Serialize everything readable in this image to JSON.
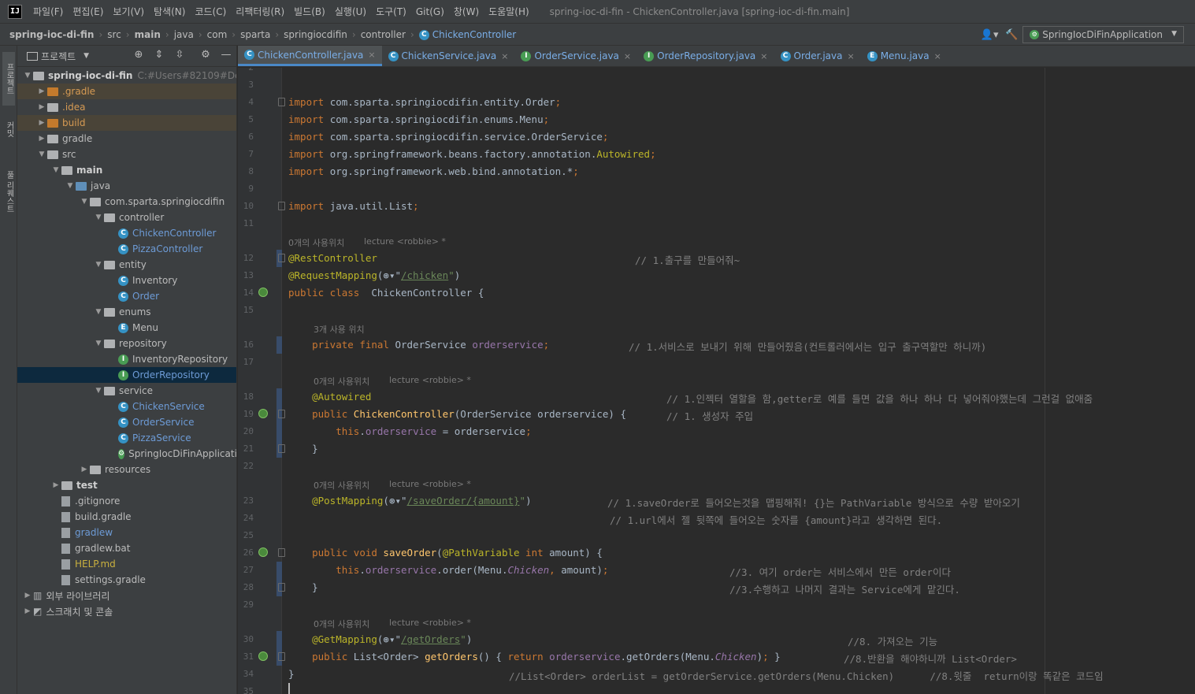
{
  "menubar": {
    "logo": "IJ",
    "items": [
      "파일(F)",
      "편집(E)",
      "보기(V)",
      "탐색(N)",
      "코드(C)",
      "리팩터링(R)",
      "빌드(B)",
      "실행(U)",
      "도구(T)",
      "Git(G)",
      "창(W)",
      "도움말(H)"
    ],
    "window_title": "spring-ioc-di-fin - ChickenController.java [spring-ioc-di-fin.main]"
  },
  "navbar": {
    "crumbs": [
      "spring-ioc-di-fin",
      "src",
      "main",
      "java",
      "com",
      "sparta",
      "springiocdifin",
      "controller",
      "ChickenController"
    ],
    "class_icon": "C",
    "run_config": "SpringIocDiFinApplication"
  },
  "toolstrip": {
    "tabs": [
      "프로젝트",
      "커밋",
      "풀 리퀘스트"
    ]
  },
  "project": {
    "title": "프로젝트",
    "tree": [
      {
        "depth": 0,
        "arrow": "▼",
        "icon": "folder",
        "label": "spring-ioc-di-fin",
        "style": "bold",
        "hint": "C:#Users#82109#Deskto"
      },
      {
        "depth": 1,
        "arrow": "▶",
        "icon": "folder-orange",
        "label": ".gradle",
        "style": "orange",
        "row": "hl"
      },
      {
        "depth": 1,
        "arrow": "▶",
        "icon": "folder",
        "label": ".idea",
        "style": "orange"
      },
      {
        "depth": 1,
        "arrow": "▶",
        "icon": "folder-orange",
        "label": "build",
        "style": "orange",
        "row": "hl"
      },
      {
        "depth": 1,
        "arrow": "▶",
        "icon": "folder",
        "label": "gradle",
        "style": ""
      },
      {
        "depth": 1,
        "arrow": "▼",
        "icon": "folder",
        "label": "src",
        "style": ""
      },
      {
        "depth": 2,
        "arrow": "▼",
        "icon": "folder",
        "label": "main",
        "style": "bold"
      },
      {
        "depth": 3,
        "arrow": "▼",
        "icon": "folder-blue",
        "label": "java",
        "style": ""
      },
      {
        "depth": 4,
        "arrow": "▼",
        "icon": "folder",
        "label": "com.sparta.springiocdifin",
        "style": ""
      },
      {
        "depth": 5,
        "arrow": "▼",
        "icon": "folder",
        "label": "controller",
        "style": ""
      },
      {
        "depth": 6,
        "arrow": "",
        "icon": "class",
        "label": "ChickenController",
        "style": "blue"
      },
      {
        "depth": 6,
        "arrow": "",
        "icon": "class",
        "label": "PizzaController",
        "style": "blue"
      },
      {
        "depth": 5,
        "arrow": "▼",
        "icon": "folder",
        "label": "entity",
        "style": ""
      },
      {
        "depth": 6,
        "arrow": "",
        "icon": "class",
        "label": "Inventory",
        "style": ""
      },
      {
        "depth": 6,
        "arrow": "",
        "icon": "class",
        "label": "Order",
        "style": "blue"
      },
      {
        "depth": 5,
        "arrow": "▼",
        "icon": "folder",
        "label": "enums",
        "style": ""
      },
      {
        "depth": 6,
        "arrow": "",
        "icon": "enum",
        "label": "Menu",
        "style": ""
      },
      {
        "depth": 5,
        "arrow": "▼",
        "icon": "folder",
        "label": "repository",
        "style": ""
      },
      {
        "depth": 6,
        "arrow": "",
        "icon": "interface",
        "label": "InventoryRepository",
        "style": ""
      },
      {
        "depth": 6,
        "arrow": "",
        "icon": "interface",
        "label": "OrderRepository",
        "style": "blue",
        "row": "sel"
      },
      {
        "depth": 5,
        "arrow": "▼",
        "icon": "folder",
        "label": "service",
        "style": ""
      },
      {
        "depth": 6,
        "arrow": "",
        "icon": "class",
        "label": "ChickenService",
        "style": "blue"
      },
      {
        "depth": 6,
        "arrow": "",
        "icon": "class",
        "label": "OrderService",
        "style": "blue"
      },
      {
        "depth": 6,
        "arrow": "",
        "icon": "class",
        "label": "PizzaService",
        "style": "blue"
      },
      {
        "depth": 6,
        "arrow": "",
        "icon": "springapp",
        "label": "SpringIocDiFinApplication",
        "style": ""
      },
      {
        "depth": 4,
        "arrow": "▶",
        "icon": "folder",
        "label": "resources",
        "style": ""
      },
      {
        "depth": 2,
        "arrow": "▶",
        "icon": "folder",
        "label": "test",
        "style": "bold"
      },
      {
        "depth": 2,
        "arrow": "",
        "icon": "file",
        "label": ".gitignore",
        "style": ""
      },
      {
        "depth": 2,
        "arrow": "",
        "icon": "file",
        "label": "build.gradle",
        "style": ""
      },
      {
        "depth": 2,
        "arrow": "",
        "icon": "file",
        "label": "gradlew",
        "style": "blue"
      },
      {
        "depth": 2,
        "arrow": "",
        "icon": "file",
        "label": "gradlew.bat",
        "style": ""
      },
      {
        "depth": 2,
        "arrow": "",
        "icon": "file",
        "label": "HELP.md",
        "style": "yellow"
      },
      {
        "depth": 2,
        "arrow": "",
        "icon": "file",
        "label": "settings.gradle",
        "style": ""
      },
      {
        "depth": 0,
        "arrow": "▶",
        "icon": "lib",
        "label": "외부 라이브러리",
        "style": ""
      },
      {
        "depth": 0,
        "arrow": "▶",
        "icon": "scratch",
        "label": "스크래치 및 콘솔",
        "style": ""
      }
    ]
  },
  "tabs": [
    {
      "label": "ChickenController.java",
      "icon": "C",
      "active": true
    },
    {
      "label": "ChickenService.java",
      "icon": "C",
      "active": false
    },
    {
      "label": "OrderService.java",
      "icon": "I",
      "active": false
    },
    {
      "label": "OrderRepository.java",
      "icon": "I",
      "active": false
    },
    {
      "label": "Order.java",
      "icon": "C",
      "active": false
    },
    {
      "label": "Menu.java",
      "icon": "E",
      "active": false
    }
  ],
  "code": {
    "line_numbers": [
      "2",
      "3",
      "4",
      "5",
      "6",
      "7",
      "8",
      "9",
      "10",
      "11",
      "",
      "12",
      "13",
      "14",
      "15",
      "",
      "16",
      "17",
      "",
      "18",
      "19",
      "20",
      "21",
      "22",
      "",
      "23",
      "24",
      "25",
      "26",
      "27",
      "28",
      "29",
      "",
      "30",
      "31",
      "34",
      "35"
    ],
    "usage_hints": {
      "h1": "0개의 사용위치",
      "h1_author": "lecture <robbie> *",
      "h2": "3개 사용 위치",
      "h3": "0개의 사용위치",
      "h3_author": "lecture <robbie> *",
      "h4": "0개의 사용위치",
      "h4_author": "lecture <robbie> *",
      "h5": "0개의 사용위치",
      "h5_author": "lecture <robbie> *"
    },
    "comments": {
      "c12": "// 1.출구를 만들어줘~",
      "c16": "// 1.서비스로 보내기 위해 만들어줬음(컨트롤러에서는 입구 출구역할만 하니까)",
      "c18": "// 1.인젝터 열할을 함,getter로 예를 들면 값을 하나 하나 다 넣어줘야했는데 그런걸 없애줌",
      "c19": "// 1. 생성자 주입",
      "c23": "// 1.saveOrder로 들어오는것을 맵핑해줘! {}는 PathVariable 방식으로 수량 받아오기",
      "c24": "// 1.url에서 젤 뒷쪽에 들어오는 숫자를 {amount}라고 생각하면 된다.",
      "c27": "//3. 여기 order는 서비스에서 만든 order이다",
      "c28": "//3.수행하고 나머지 결과는 Service에게 맡긴다.",
      "c30": "//8. 가져오는 기능",
      "c31": "//8.반환을 해야하니까 List<Order>",
      "c34": "//List<Order> orderList = getOrderService.getOrders(Menu.Chicken)      //8.윗줄  return이랑 똑같은 코드임"
    }
  }
}
